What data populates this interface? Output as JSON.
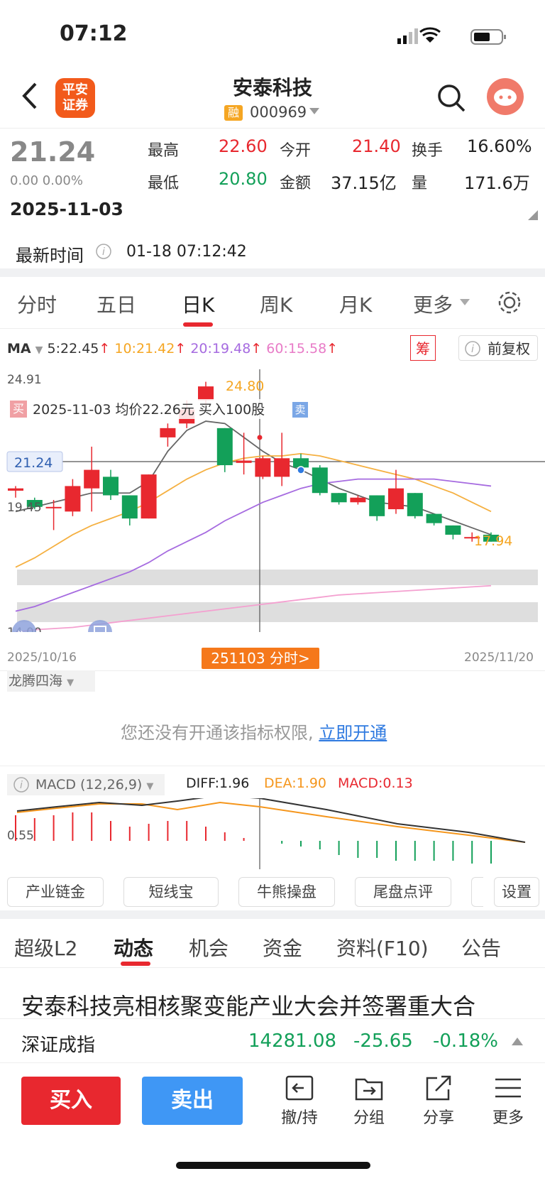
{
  "status": {
    "time": "07:12"
  },
  "header": {
    "logo_text_1": "平安",
    "logo_text_2": "证券",
    "title": "安泰科技",
    "rong_badge": "融",
    "code": "000969"
  },
  "quote": {
    "price": "21.24",
    "change": "0.00 0.00%",
    "date": "2025-11-03",
    "high_label": "最高",
    "high": "22.60",
    "open_label": "今开",
    "open": "21.40",
    "turnover_label": "换手",
    "turnover": "16.60%",
    "low_label": "最低",
    "low": "20.80",
    "amount_label": "金额",
    "amount": "37.15亿",
    "volume_label": "量",
    "volume": "171.6万",
    "latest_time_label": "最新时间",
    "latest_time": "01-18 07:12:42"
  },
  "period_tabs": [
    "分时",
    "五日",
    "日K",
    "周K",
    "月K",
    "更多"
  ],
  "active_tab": "日K",
  "ma": {
    "label": "MA",
    "ma5": "5:22.45",
    "ma10": "10:21.42",
    "ma20": "20:19.48",
    "ma60": "60:15.58",
    "chip_label": "筹",
    "adjust_label": "前复权"
  },
  "kline": {
    "y_top": "24.91",
    "y_mid": "19.45",
    "y_bottom": "14.00",
    "max_label": "24.80",
    "min_label": "17.94",
    "price_tag": "21.24",
    "buy_badge": "买",
    "sell_badge": "卖",
    "trade_note": "2025-11-03 均价22.26元 买入100股",
    "date_start": "2025/10/16",
    "date_end": "2025/11/20",
    "crosshair_tag": "251103 分时>",
    "candles": [
      {
        "o": 20.1,
        "c": 20.2,
        "h": 20.3,
        "l": 19.8
      },
      {
        "o": 19.7,
        "c": 19.4,
        "h": 19.8,
        "l": 19.3
      },
      {
        "o": 19.4,
        "c": 19.4,
        "h": 19.7,
        "l": 18.4
      },
      {
        "o": 19.2,
        "c": 20.3,
        "h": 20.6,
        "l": 19.0
      },
      {
        "o": 20.2,
        "c": 21.0,
        "h": 22.0,
        "l": 19.2
      },
      {
        "o": 20.7,
        "c": 19.9,
        "h": 21.0,
        "l": 19.7
      },
      {
        "o": 19.9,
        "c": 18.9,
        "h": 19.9,
        "l": 18.6
      },
      {
        "o": 18.9,
        "c": 20.8,
        "h": 20.8,
        "l": 18.9
      },
      {
        "o": 22.4,
        "c": 22.8,
        "h": 23.0,
        "l": 22.0
      },
      {
        "o": 23.0,
        "c": 23.6,
        "h": 24.0,
        "l": 22.8
      },
      {
        "o": 24.0,
        "c": 24.6,
        "h": 24.8,
        "l": 23.8
      },
      {
        "o": 22.8,
        "c": 21.2,
        "h": 22.8,
        "l": 20.9
      },
      {
        "o": 21.3,
        "c": 21.4,
        "h": 22.6,
        "l": 20.8
      },
      {
        "o": 20.7,
        "c": 21.5,
        "h": 21.6,
        "l": 20.6
      },
      {
        "o": 20.7,
        "c": 21.5,
        "h": 22.6,
        "l": 20.3
      },
      {
        "o": 21.5,
        "c": 21.1,
        "h": 21.7,
        "l": 20.9
      },
      {
        "o": 21.1,
        "c": 20.0,
        "h": 21.2,
        "l": 19.9
      },
      {
        "o": 20.0,
        "c": 19.6,
        "h": 20.0,
        "l": 19.5
      },
      {
        "o": 19.6,
        "c": 19.8,
        "h": 19.9,
        "l": 19.5
      },
      {
        "o": 19.9,
        "c": 19.0,
        "h": 19.9,
        "l": 18.8
      },
      {
        "o": 19.3,
        "c": 20.2,
        "h": 21.0,
        "l": 19.1
      },
      {
        "o": 20.0,
        "c": 19.0,
        "h": 20.0,
        "l": 18.9
      },
      {
        "o": 19.1,
        "c": 18.7,
        "h": 19.1,
        "l": 18.6
      },
      {
        "o": 18.6,
        "c": 18.2,
        "h": 18.6,
        "l": 18.0
      },
      {
        "o": 18.1,
        "c": 18.1,
        "h": 18.3,
        "l": 17.9
      },
      {
        "o": 18.2,
        "c": 17.9,
        "h": 18.3,
        "l": 17.9
      }
    ],
    "ma5_values": [
      19.2,
      19.4,
      19.6,
      19.8,
      20.0,
      20.0,
      20.0,
      20.5,
      21.8,
      22.7,
      23.1,
      23.0,
      22.4,
      21.8,
      21.3,
      21.0,
      20.6,
      20.2,
      19.9,
      19.6,
      19.5,
      19.4,
      19.1,
      18.8,
      18.5,
      18.2
    ],
    "ma10_values": [
      16.8,
      17.2,
      17.7,
      18.2,
      18.6,
      18.9,
      19.2,
      19.6,
      20.1,
      20.6,
      21.0,
      21.3,
      21.5,
      21.6,
      21.6,
      21.7,
      21.6,
      21.4,
      21.2,
      21.0,
      20.8,
      20.6,
      20.3,
      20.0,
      19.6,
      19.2
    ],
    "ma20_values": [
      14.9,
      15.1,
      15.4,
      15.7,
      16.0,
      16.3,
      16.6,
      17.0,
      17.5,
      17.9,
      18.3,
      18.8,
      19.2,
      19.6,
      19.9,
      20.2,
      20.4,
      20.5,
      20.6,
      20.6,
      20.6,
      20.6,
      20.6,
      20.5,
      20.4,
      20.3
    ],
    "ma60_values": [
      14.0,
      14.1,
      14.15,
      14.2,
      14.3,
      14.4,
      14.5,
      14.6,
      14.7,
      14.8,
      14.9,
      15.0,
      15.1,
      15.2,
      15.3,
      15.4,
      15.5,
      15.6,
      15.65,
      15.7,
      15.75,
      15.8,
      15.85,
      15.9,
      15.95,
      16.0
    ]
  },
  "indicator": {
    "name": "龙腾四海",
    "locked_text": "您还没有开通该指标权限,",
    "unlock_link": "立即开通"
  },
  "macd": {
    "label": "MACD (12,26,9)",
    "diff": "DIFF:1.96",
    "dea": "DEA:1.90",
    "macd": "MACD:0.13",
    "y_label": "0.55",
    "hist": [
      0.9,
      0.8,
      0.9,
      1.0,
      1.0,
      0.7,
      0.5,
      0.6,
      0.7,
      0.7,
      0.5,
      0.3,
      0.1,
      0.0,
      -0.1,
      -0.2,
      -0.3,
      -0.5,
      -0.6,
      -0.6,
      -0.7,
      -0.7,
      -0.7,
      -0.7,
      -0.8,
      -0.8
    ]
  },
  "feature_buttons": [
    "产业链金",
    "短线宝",
    "牛熊操盘",
    "尾盘点评",
    "设置"
  ],
  "subtabs": [
    "超级L2",
    "动态",
    "机会",
    "资金",
    "资料(F10)",
    "公告"
  ],
  "active_subtab": "动态",
  "news_headline": "安泰科技亮相核聚变能产业大会并签署重大合",
  "index": {
    "name": "深证成指",
    "value": "14281.08",
    "change": "-25.65",
    "pct": "-0.18%"
  },
  "actions": {
    "buy": "买入",
    "sell": "卖出",
    "tools": [
      "撤/持",
      "分组",
      "分享",
      "更多"
    ]
  }
}
